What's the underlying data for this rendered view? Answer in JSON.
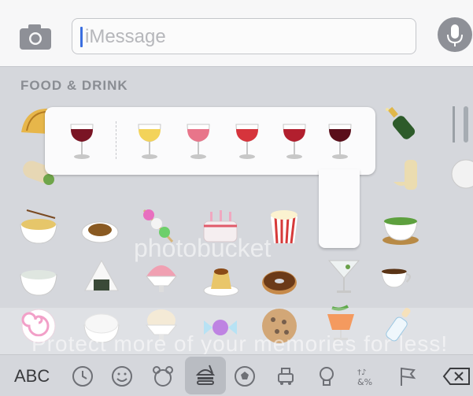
{
  "input": {
    "placeholder": "iMessage"
  },
  "keyboard": {
    "category_title": "FOOD & DRINK"
  },
  "popup": {
    "variants": [
      "red-wine-glass",
      "white-wine-glass",
      "rose-wine-glass",
      "red-wine-glass-light",
      "red-wine-glass-medium",
      "red-wine-glass-dark"
    ]
  },
  "bottom": {
    "abc_label": "ABC"
  },
  "watermark": {
    "brand": "photobucket",
    "slogan": "Protect more of your memories for less!"
  },
  "colors": {
    "wine_dark": "#7a1424",
    "wine_light": "#f3d35a",
    "wine_rose": "#e8758a",
    "wine_red": "#d6343c",
    "mic": "#8e9097"
  }
}
